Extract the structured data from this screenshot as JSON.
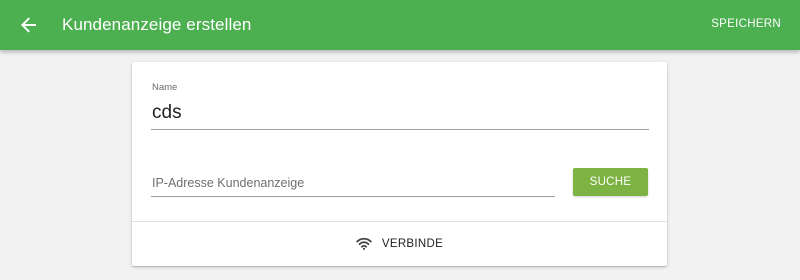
{
  "header": {
    "back_icon": "arrow-left-icon",
    "title": "Kundenanzeige erstellen",
    "save_label": "SPEICHERN",
    "color": "#4caf50"
  },
  "form": {
    "name": {
      "label": "Name",
      "value": "cds"
    },
    "ip": {
      "placeholder": "IP-Adresse Kundenanzeige",
      "value": ""
    },
    "search_label": "SUCHE",
    "search_color": "#7cb342"
  },
  "footer": {
    "connect_icon": "wifi-icon",
    "connect_label": "VERBINDE"
  }
}
